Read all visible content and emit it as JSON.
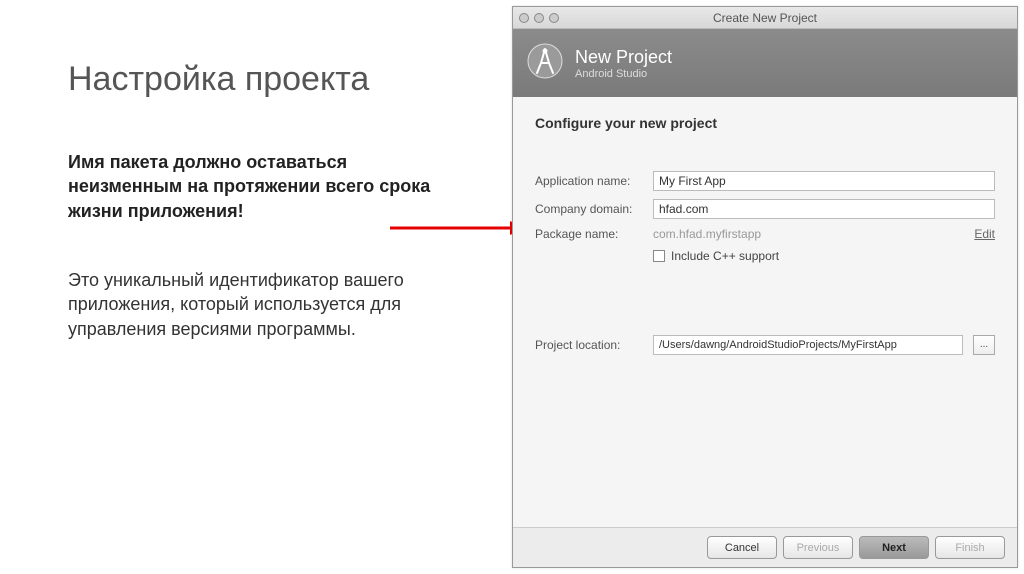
{
  "slide": {
    "title": "Настройка проекта",
    "boldText": "Имя пакета должно оставаться неизменным на протяжении всего срока жизни приложения!",
    "paragraph": "Это уникальный идентификатор вашего приложения, который используется для управления версиями программы."
  },
  "dialog": {
    "windowTitle": "Create New Project",
    "header": {
      "title": "New Project",
      "subtitle": "Android Studio"
    },
    "sectionTitle": "Configure your new project",
    "fields": {
      "appNameLabel": "Application name:",
      "appNameValue": "My First App",
      "companyLabel": "Company domain:",
      "companyValue": "hfad.com",
      "packageLabel": "Package name:",
      "packageValue": "com.hfad.myfirstapp",
      "editLink": "Edit",
      "cppLabel": "Include C++ support",
      "locationLabel": "Project location:",
      "locationValue": "/Users/dawng/AndroidStudioProjects/MyFirstApp",
      "browseLabel": "..."
    },
    "buttons": {
      "cancel": "Cancel",
      "previous": "Previous",
      "next": "Next",
      "finish": "Finish"
    }
  }
}
